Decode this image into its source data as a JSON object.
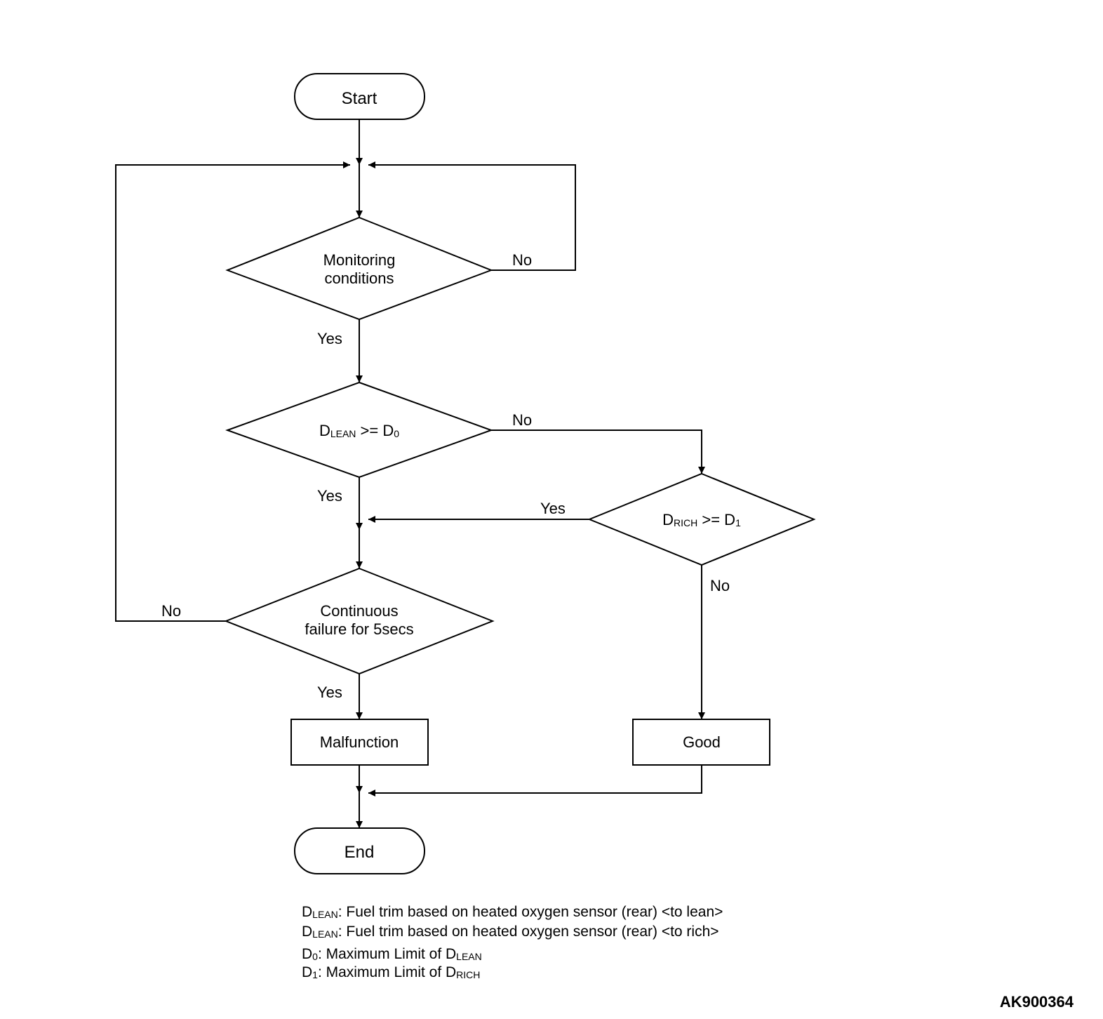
{
  "nodes": {
    "start": "Start",
    "monitoring": {
      "l1": "Monitoring",
      "l2": "conditions"
    },
    "lean": {
      "prefix": "D",
      "sub1": "LEAN",
      "mid": " >= D",
      "sub2": "0"
    },
    "rich": {
      "prefix": "D",
      "sub1": "RICH",
      "mid": " >= D",
      "sub2": "1"
    },
    "failure": {
      "l1": "Continuous",
      "l2": "failure for 5secs"
    },
    "malfunction": "Malfunction",
    "good": "Good",
    "end": "End"
  },
  "edges": {
    "yes": "Yes",
    "no": "No"
  },
  "legend": {
    "l1": {
      "p1": "D",
      "s1": "LEAN",
      "p2": ": Fuel trim based on heated oxygen sensor (rear) <to lean>"
    },
    "l2": {
      "p1": "D",
      "s1": "LEAN",
      "p2": ": Fuel trim based on heated oxygen sensor (rear) <to rich>"
    },
    "l3": {
      "p1": "D",
      "s1": "0",
      "p2": ": Maximum Limit of D",
      "s2": "LEAN"
    },
    "l4": {
      "p1": "D",
      "s1": "1",
      "p2": ": Maximum Limit of D",
      "s2": "RICH"
    }
  },
  "footer": "AK900364"
}
